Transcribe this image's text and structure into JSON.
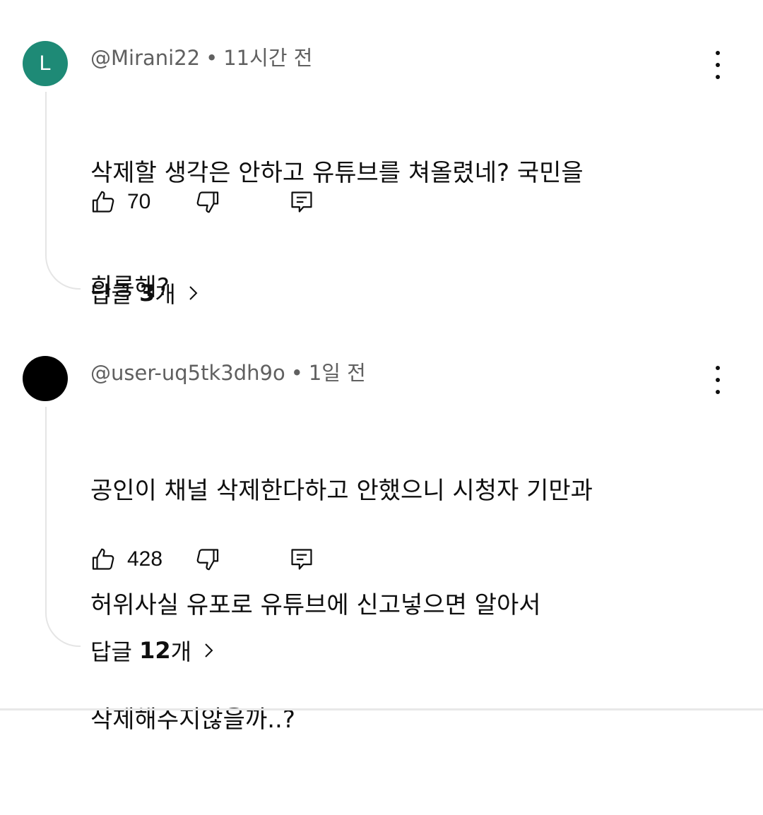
{
  "comments": [
    {
      "avatar_letter": "L",
      "avatar_color": "#1e8a76",
      "author": "@Mirani22",
      "separator": "•",
      "time": "11시간 전",
      "lines": [
        "삭제할 생각은 안하고 유튜브를 쳐올렸네? 국민을",
        "희롱해?"
      ],
      "like_count": "70",
      "replies_prefix": "답글 ",
      "replies_count": "3",
      "replies_suffix": "개"
    },
    {
      "avatar_letter": "",
      "avatar_color": "#000000",
      "author": "@user-uq5tk3dh9o",
      "separator": "•",
      "time": "1일 전",
      "lines": [
        "공인이 채널 삭제한다하고 안했으니 시청자 기만과",
        "허위사실 유포로 유튜브에 신고넣으면 알아서",
        "삭제해주지않을까..?"
      ],
      "like_count": "428",
      "replies_prefix": "답글 ",
      "replies_count": "12",
      "replies_suffix": "개"
    }
  ],
  "icons": {
    "like": "thumbs-up-icon",
    "dislike": "thumbs-down-icon",
    "reply": "comment-reply-icon",
    "more": "more-vert-icon",
    "expand": "chevron-right-icon"
  }
}
